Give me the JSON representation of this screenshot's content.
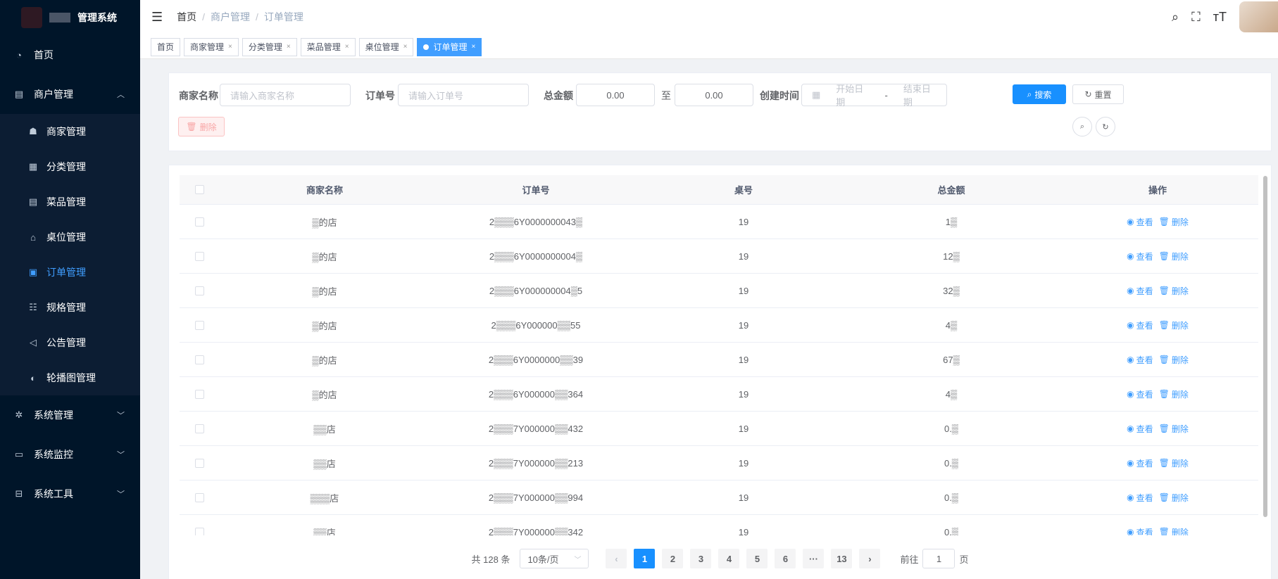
{
  "app": {
    "title": "管理系统"
  },
  "sidebar": {
    "home": "首页",
    "merchant_group": "商户管理",
    "sub_items": [
      {
        "label": "商家管理",
        "icon": "users-icon"
      },
      {
        "label": "分类管理",
        "icon": "grid-icon"
      },
      {
        "label": "菜品管理",
        "icon": "list-icon"
      },
      {
        "label": "桌位管理",
        "icon": "table-icon"
      },
      {
        "label": "订单管理",
        "icon": "order-icon",
        "active": true
      },
      {
        "label": "规格管理",
        "icon": "spec-icon"
      },
      {
        "label": "公告管理",
        "icon": "speaker-icon"
      },
      {
        "label": "轮播图管理",
        "icon": "carousel-icon"
      }
    ],
    "system": "系统管理",
    "monitor": "系统监控",
    "tools": "系统工具"
  },
  "breadcrumb": {
    "home": "首页",
    "level1": "商户管理",
    "level2": "订单管理"
  },
  "tags": [
    {
      "label": "首页",
      "closable": false
    },
    {
      "label": "商家管理",
      "closable": true
    },
    {
      "label": "分类管理",
      "closable": true
    },
    {
      "label": "菜品管理",
      "closable": true
    },
    {
      "label": "桌位管理",
      "closable": true
    },
    {
      "label": "订单管理",
      "closable": true,
      "active": true
    }
  ],
  "search": {
    "merchant_label": "商家名称",
    "merchant_placeholder": "请输入商家名称",
    "order_label": "订单号",
    "order_placeholder": "请输入订单号",
    "amount_label": "总金额",
    "amount_min": "0.00",
    "to": "至",
    "amount_max": "0.00",
    "created_label": "创建时间",
    "start_placeholder": "开始日期",
    "date_sep": "-",
    "end_placeholder": "结束日期",
    "search_btn": "搜索",
    "reset_btn": "重置",
    "delete_btn": "删除"
  },
  "table": {
    "headers": [
      "商家名称",
      "订单号",
      "桌号",
      "总金额",
      "操作"
    ],
    "view_label": "查看",
    "delete_label": "删除",
    "rows": [
      {
        "name": "▒的店",
        "order": "2▒▒▒6Y0000000043▒",
        "table": "19",
        "amount": "1▒"
      },
      {
        "name": "▒的店",
        "order": "2▒▒▒6Y0000000004▒",
        "table": "19",
        "amount": "12▒"
      },
      {
        "name": "▒的店",
        "order": "2▒▒▒6Y000000004▒5",
        "table": "19",
        "amount": "32▒"
      },
      {
        "name": "▒的店",
        "order": "2▒▒▒6Y000000▒▒55",
        "table": "19",
        "amount": "4▒"
      },
      {
        "name": "▒的店",
        "order": "2▒▒▒6Y0000000▒▒39",
        "table": "19",
        "amount": "67▒"
      },
      {
        "name": "▒的店",
        "order": "2▒▒▒6Y000000▒▒364",
        "table": "19",
        "amount": "4▒"
      },
      {
        "name": "▒▒店",
        "order": "2▒▒▒7Y000000▒▒432",
        "table": "19",
        "amount": "0.▒"
      },
      {
        "name": "▒▒店",
        "order": "2▒▒▒7Y000000▒▒213",
        "table": "19",
        "amount": "0.▒"
      },
      {
        "name": "▒▒▒店",
        "order": "2▒▒▒7Y000000▒▒994",
        "table": "19",
        "amount": "0.▒"
      },
      {
        "name": "▒▒店",
        "order": "2▒▒▒7Y000000▒▒342",
        "table": "19",
        "amount": "0.▒"
      }
    ]
  },
  "pagination": {
    "total": "共 128 条",
    "page_size": "10条/页",
    "pages": [
      "1",
      "2",
      "3",
      "4",
      "5",
      "6",
      "···",
      "13"
    ],
    "current": "1",
    "goto_label": "前往",
    "goto_value": "1",
    "page_suffix": "页"
  },
  "colors": {
    "sidebar_bg": "#001529",
    "primary": "#1890ff",
    "active_menu": "#409eff"
  }
}
